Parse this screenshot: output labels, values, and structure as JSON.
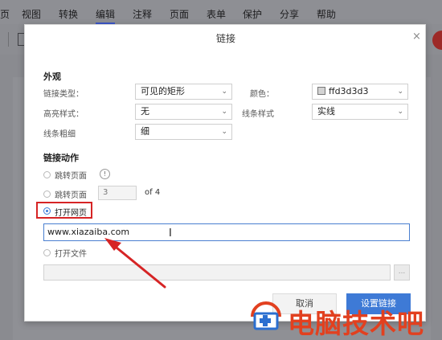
{
  "menubar": {
    "items": [
      "页",
      "视图",
      "转换",
      "编辑",
      "注释",
      "页面",
      "表单",
      "保护",
      "分享",
      "帮助"
    ],
    "active_index": 3
  },
  "dialog": {
    "title": "链接",
    "close_glyph": "×",
    "appearance": {
      "section_title": "外观",
      "link_type_label": "链接类型：",
      "link_type_value": "可见的矩形",
      "color_label": "颜色：",
      "color_value": "ffd3d3d3",
      "color_hex": "#d3d3d3",
      "highlight_label": "高亮样式：",
      "highlight_value": "无",
      "line_style_label": "线条样式",
      "line_style_value": "实线",
      "line_width_label": "线条粗细",
      "line_width_value": "细"
    },
    "action": {
      "section_title": "链接动作",
      "jump_page_label": "跳转页面",
      "jump_page_info": "!",
      "jump_page2_label": "跳转页面",
      "page_number": "3",
      "page_total": "of 4",
      "open_web_label": "打开网页",
      "url_value": "www.xiazaiba.com",
      "open_file_label": "打开文件",
      "browse_label": "..."
    },
    "buttons": {
      "cancel": "取消",
      "ok": "设置链接"
    }
  },
  "watermark": {
    "text": "电脑技术吧"
  },
  "colors": {
    "accent": "#3e7ad6",
    "highlight_red": "#d62425",
    "watermark": "#e2401f"
  }
}
